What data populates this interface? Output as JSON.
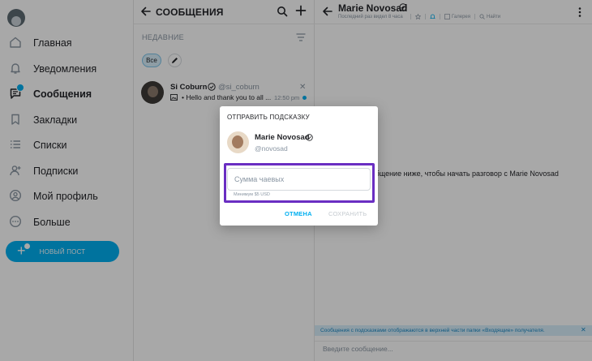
{
  "nav": {
    "items": [
      {
        "label": "Главная",
        "icon": "home-icon"
      },
      {
        "label": "Уведомления",
        "icon": "bell-icon"
      },
      {
        "label": "Сообщения",
        "icon": "messages-icon",
        "active": true
      },
      {
        "label": "Закладки",
        "icon": "bookmark-icon"
      },
      {
        "label": "Списки",
        "icon": "lists-icon"
      },
      {
        "label": "Подписки",
        "icon": "subscriptions-icon"
      },
      {
        "label": "Мой профиль",
        "icon": "profile-icon"
      },
      {
        "label": "Больше",
        "icon": "more-icon"
      }
    ],
    "new_post": "НОВЫЙ ПОСТ"
  },
  "messages": {
    "title": "СООБЩЕНИЯ",
    "recent": "НЕДАВНИЕ",
    "filter_all": "Все",
    "chats": [
      {
        "name": "Si Coburn",
        "handle": "@si_coburn",
        "preview": "• Hello and thank you to all ...",
        "time": "12:50 pm",
        "unread": true
      }
    ]
  },
  "chat": {
    "name": "Marie Novosad",
    "last_seen": "Последний раз видел 8 часа",
    "tools": [
      "Галерея",
      "Найти"
    ],
    "start_text": "сообщение ниже, чтобы начать разговор с Marie Novosad",
    "tip_banner": "Сообщения с подсказками отображаются в верхней части папки «Входящие» получателя.",
    "compose_placeholder": "Введите сообщение..."
  },
  "modal": {
    "title": "ОТПРАВИТЬ ПОДСКАЗКУ",
    "name": "Marie Novosad",
    "handle": "@novosad",
    "amount_placeholder": "Сумма чаевых",
    "amount_value": "",
    "hint": "Минимум $5 USD",
    "cancel": "ОТМЕНА",
    "save": "СОХРАНИТЬ"
  },
  "colors": {
    "accent": "#00aff0",
    "focus_outline": "#6a2ec2",
    "muted": "#8a96a3",
    "banner_bg": "#d8effb"
  }
}
